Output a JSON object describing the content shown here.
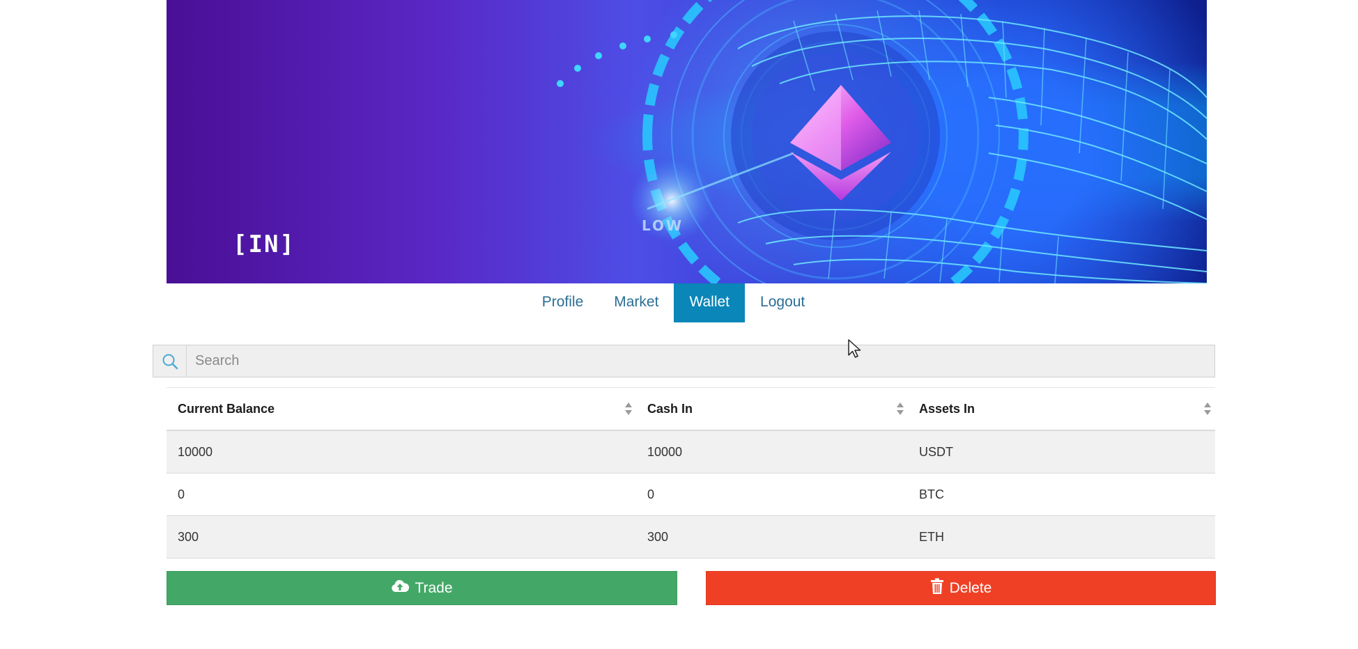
{
  "banner": {
    "logo_text": "[IN]",
    "overlay_word": "LOW"
  },
  "nav": {
    "items": [
      {
        "label": "Profile",
        "active": false
      },
      {
        "label": "Market",
        "active": false
      },
      {
        "label": "Wallet",
        "active": true
      },
      {
        "label": "Logout",
        "active": false
      }
    ]
  },
  "search": {
    "placeholder": "Search",
    "value": "",
    "icon": "search-icon"
  },
  "table": {
    "columns": [
      "Current Balance",
      "Cash In",
      "Assets In"
    ],
    "rows": [
      [
        "10000",
        "10000",
        "USDT"
      ],
      [
        "0",
        "0",
        "BTC"
      ],
      [
        "300",
        "300",
        "ETH"
      ]
    ]
  },
  "actions": {
    "trade_label": "Trade",
    "trade_icon": "cloud-upload-icon",
    "delete_label": "Delete",
    "delete_icon": "trash-icon"
  },
  "colors": {
    "accent": "#0a86b8",
    "link": "#2a6e95",
    "trade": "#43a867",
    "delete": "#ef4025"
  }
}
